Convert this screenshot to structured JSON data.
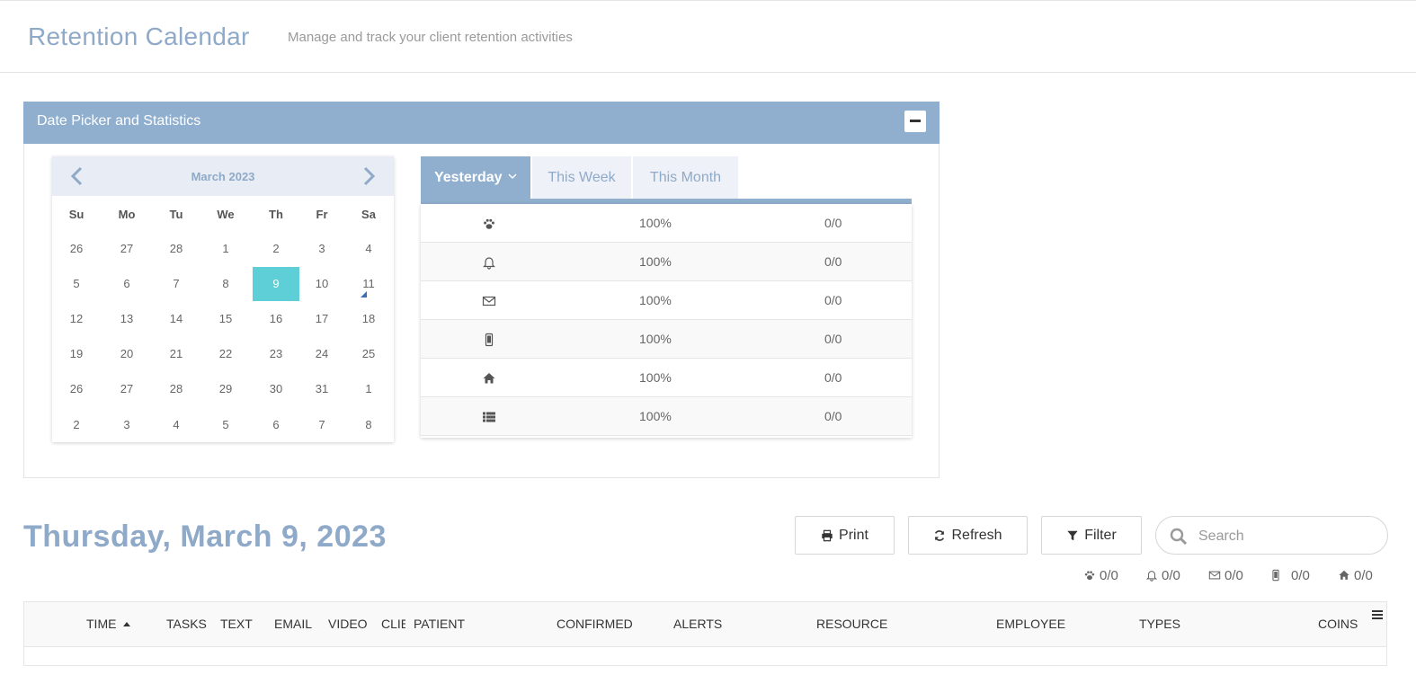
{
  "header": {
    "title": "Retention Calendar",
    "subtitle": "Manage and track your client retention activities"
  },
  "panel": {
    "title": "Date Picker and Statistics"
  },
  "calendar": {
    "month_label": "March 2023",
    "weekdays": [
      "Su",
      "Mo",
      "Tu",
      "We",
      "Th",
      "Fr",
      "Sa"
    ],
    "weeks": [
      [
        "26",
        "27",
        "28",
        "1",
        "2",
        "3",
        "4"
      ],
      [
        "5",
        "6",
        "7",
        "8",
        "9",
        "10",
        "11"
      ],
      [
        "12",
        "13",
        "14",
        "15",
        "16",
        "17",
        "18"
      ],
      [
        "19",
        "20",
        "21",
        "22",
        "23",
        "24",
        "25"
      ],
      [
        "26",
        "27",
        "28",
        "29",
        "30",
        "31",
        "1"
      ],
      [
        "2",
        "3",
        "4",
        "5",
        "6",
        "7",
        "8"
      ]
    ],
    "selected_day": "9"
  },
  "stats": {
    "tabs": [
      {
        "label": "Yesterday"
      },
      {
        "label": "This Week"
      },
      {
        "label": "This Month"
      }
    ],
    "rows": [
      {
        "icon": "paw-icon",
        "percent": "100%",
        "count": "0/0"
      },
      {
        "icon": "bell-icon",
        "percent": "100%",
        "count": "0/0"
      },
      {
        "icon": "envelope-icon",
        "percent": "100%",
        "count": "0/0"
      },
      {
        "icon": "mobile-icon",
        "percent": "100%",
        "count": "0/0"
      },
      {
        "icon": "home-icon",
        "percent": "100%",
        "count": "0/0"
      },
      {
        "icon": "list-icon",
        "percent": "100%",
        "count": "0/0"
      }
    ]
  },
  "day": {
    "title": "Thursday, March 9, 2023"
  },
  "toolbar": {
    "print_label": "Print",
    "refresh_label": "Refresh",
    "filter_label": "Filter",
    "search_placeholder": "Search"
  },
  "summary": {
    "paw": "0/0",
    "bell": "0/0",
    "envelope": "0/0",
    "mobile": "0/0",
    "home": "0/0"
  },
  "grid": {
    "columns": [
      "TIME",
      "TASKS",
      "TEXT",
      "EMAIL",
      "VIDEO",
      "CLIE",
      "PATIENT",
      "CONFIRMED",
      "ALERTS",
      "RESOURCE",
      "EMPLOYEE",
      "TYPES",
      "COINS"
    ]
  },
  "colors": {
    "accent": "#90aecd",
    "title": "#8fa9c8",
    "selected_day": "#5ecfd6"
  }
}
